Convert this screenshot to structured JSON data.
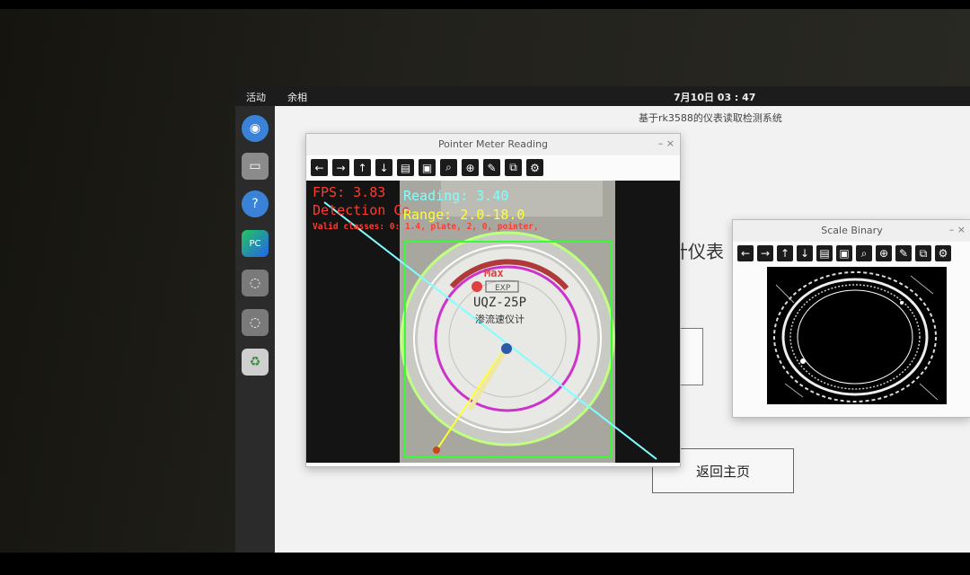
{
  "top_bar": {
    "activities": "活动",
    "app_name": "余相",
    "clock": "7月10日 03 : 47"
  },
  "dock": {
    "items": [
      "chrome-icon",
      "files-icon",
      "help-icon",
      "pycharm-icon",
      "app-icon",
      "app-icon",
      "trash-icon"
    ]
  },
  "main_window": {
    "title": "基于rk3588的仪表读取检测系统",
    "partial_label": "针仪表",
    "return_button": "返回主页"
  },
  "pointer_window": {
    "title": "Pointer Meter Reading",
    "toolbar": [
      "back-icon",
      "forward-icon",
      "up-icon",
      "down-icon",
      "configure-icon",
      "save-icon",
      "zoom-icon",
      "zoom-fit-icon",
      "edit-icon",
      "copy-icon",
      "settings-icon"
    ],
    "overlay": {
      "fps": "FPS: 3.83",
      "detection": "Detection Co",
      "valid_classes": "Valid classes: 0: 1.4, plate, 2, 0, pointer,",
      "reading": "Reading: 3.40",
      "range": "Range: 2.0-18.0",
      "max_label": "Max",
      "model": "UQZ-25P",
      "gauge_name": "渗流速仪计"
    }
  },
  "binary_window": {
    "title": "Scale Binary",
    "toolbar": [
      "back-icon",
      "forward-icon",
      "up-icon",
      "down-icon",
      "configure-icon",
      "save-icon",
      "zoom-icon",
      "zoom-fit-icon",
      "edit-icon",
      "copy-icon",
      "settings-icon"
    ]
  },
  "colors": {
    "fps": "#ff3b30",
    "reading": "#7fffff",
    "range": "#ffff33",
    "box": "#33ff33",
    "scale_arc": "#cc33cc"
  }
}
